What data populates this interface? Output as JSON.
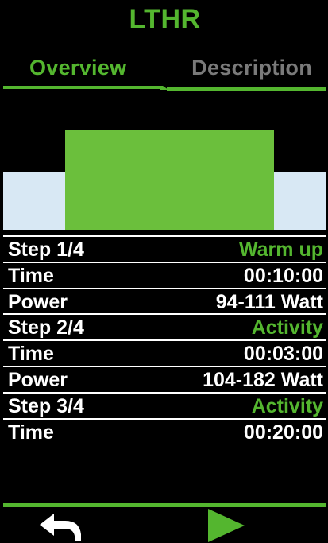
{
  "header": {
    "title": "LTHR"
  },
  "tabs": [
    {
      "label": "Overview",
      "active": true
    },
    {
      "label": "Description",
      "active": false
    }
  ],
  "colors": {
    "accent": "#54b62f",
    "power_block": "#6bbf3c",
    "zone_band": "#d8e8f4",
    "inactive_tab": "#7a7a7a"
  },
  "steps": [
    {
      "label": "Step 1/4",
      "name": "Warm up",
      "time_label": "Time",
      "time": "00:10:00",
      "power_label": "Power",
      "power": "94-111 Watt"
    },
    {
      "label": "Step 2/4",
      "name": "Activity",
      "time_label": "Time",
      "time": "00:03:00",
      "power_label": "Power",
      "power": "104-182 Watt"
    },
    {
      "label": "Step 3/4",
      "name": "Activity",
      "time_label": "Time",
      "time": "00:20:00"
    }
  ],
  "footer": {
    "back_icon": "back-arrow-icon",
    "play_icon": "play-icon"
  }
}
